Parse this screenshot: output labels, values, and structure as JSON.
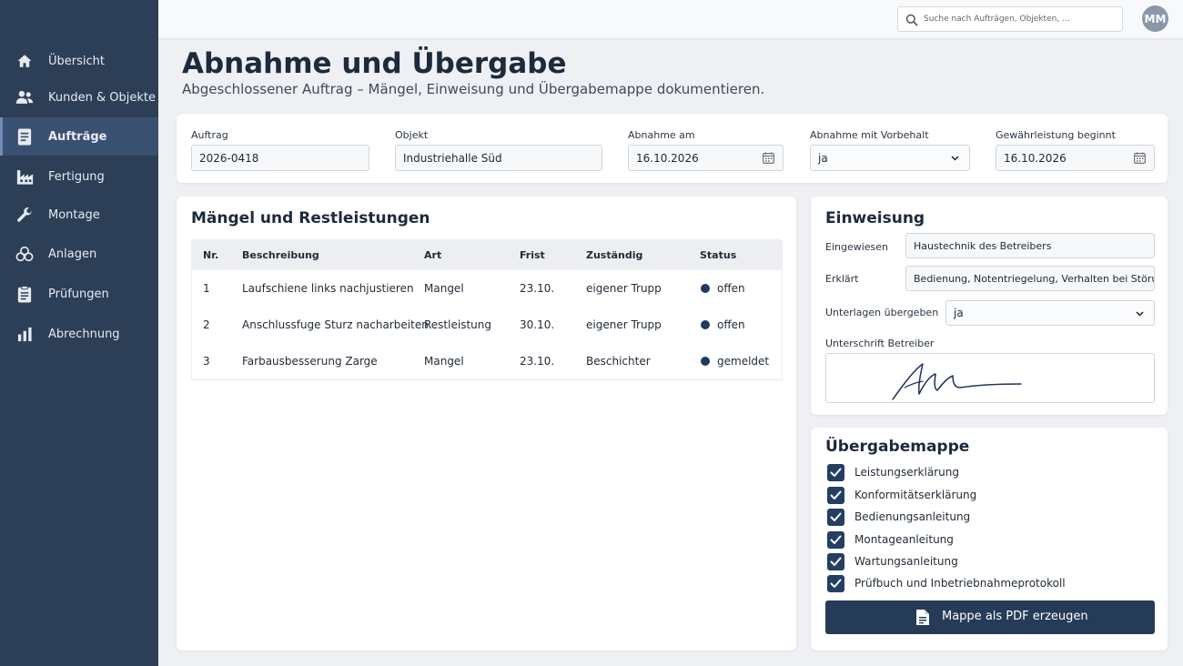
{
  "sidebar": {
    "items": [
      {
        "label": "Übersicht",
        "icon": "home-icon"
      },
      {
        "label": "Kunden & Objekte",
        "icon": "users-icon"
      },
      {
        "label": "Aufträge",
        "icon": "document-icon",
        "active": true
      },
      {
        "label": "Fertigung",
        "icon": "factory-icon"
      },
      {
        "label": "Montage",
        "icon": "wrench-icon"
      },
      {
        "label": "Anlagen",
        "icon": "gears-icon"
      },
      {
        "label": "Prüfungen",
        "icon": "clipboard-icon"
      },
      {
        "label": "Abrechnung",
        "icon": "bar-chart-icon"
      }
    ]
  },
  "topbar": {
    "search_placeholder": "Suche nach Aufträgen, Objekten, ...",
    "avatar_initials": "MM"
  },
  "header": {
    "title": "Abnahme und Übergabe",
    "subtitle": "Abgeschlossener Auftrag – Mängel, Einweisung und Übergabemappe dokumentieren."
  },
  "order_form": {
    "auftrag": {
      "label": "Auftrag",
      "value": "2026-0418"
    },
    "objekt": {
      "label": "Objekt",
      "value": "Industriehalle Süd"
    },
    "abnahme_am": {
      "label": "Abnahme am",
      "value": "16.10.2026"
    },
    "vorbehalt": {
      "label": "Abnahme mit Vorbehalt",
      "value": "ja"
    },
    "gewaehrleistung": {
      "label": "Gewährleistung beginnt",
      "value": "16.10.2026"
    }
  },
  "defects": {
    "title": "Mängel und Restleistungen",
    "columns": [
      "Nr.",
      "Beschreibung",
      "Art",
      "Frist",
      "Zuständig",
      "Status"
    ],
    "rows": [
      {
        "nr": "1",
        "beschreibung": "Laufschiene links nachjustieren",
        "art": "Mangel",
        "frist": "23.10.",
        "zustaendig": "eigener Trupp",
        "status": "offen"
      },
      {
        "nr": "2",
        "beschreibung": "Anschlussfuge Sturz nacharbeiten",
        "art": "Restleistung",
        "frist": "30.10.",
        "zustaendig": "eigener Trupp",
        "status": "offen"
      },
      {
        "nr": "3",
        "beschreibung": "Farbausbesserung Zarge",
        "art": "Mangel",
        "frist": "23.10.",
        "zustaendig": "Beschichter",
        "status": "gemeldet"
      }
    ]
  },
  "einweisung": {
    "title": "Einweisung",
    "eingewiesen": {
      "label": "Eingewiesen",
      "value": "Haustechnik des Betreibers"
    },
    "erklaert": {
      "label": "Erklärt",
      "value": "Bedienung, Notentriegelung, Verhalten bei Störung"
    },
    "unterlagen": {
      "label": "Unterlagen übergeben",
      "value": "ja"
    },
    "unterschrift": {
      "label": "Unterschrift Betreiber"
    }
  },
  "mappe": {
    "title": "Übergabemappe",
    "items": [
      {
        "label": "Leistungserklärung",
        "checked": true
      },
      {
        "label": "Konformitätserklärung",
        "checked": true
      },
      {
        "label": "Bedienungsanleitung",
        "checked": true
      },
      {
        "label": "Montageanleitung",
        "checked": true
      },
      {
        "label": "Wartungsanleitung",
        "checked": true
      },
      {
        "label": "Prüfbuch und Inbetriebnahmeprotokoll",
        "checked": true
      }
    ],
    "button_label": "Mappe als PDF erzeugen"
  },
  "colors": {
    "sidebar": "#2d3f57",
    "sidebar_active": "#3a5070",
    "accent": "#253b58",
    "status_dot": "#1f3a5f"
  }
}
